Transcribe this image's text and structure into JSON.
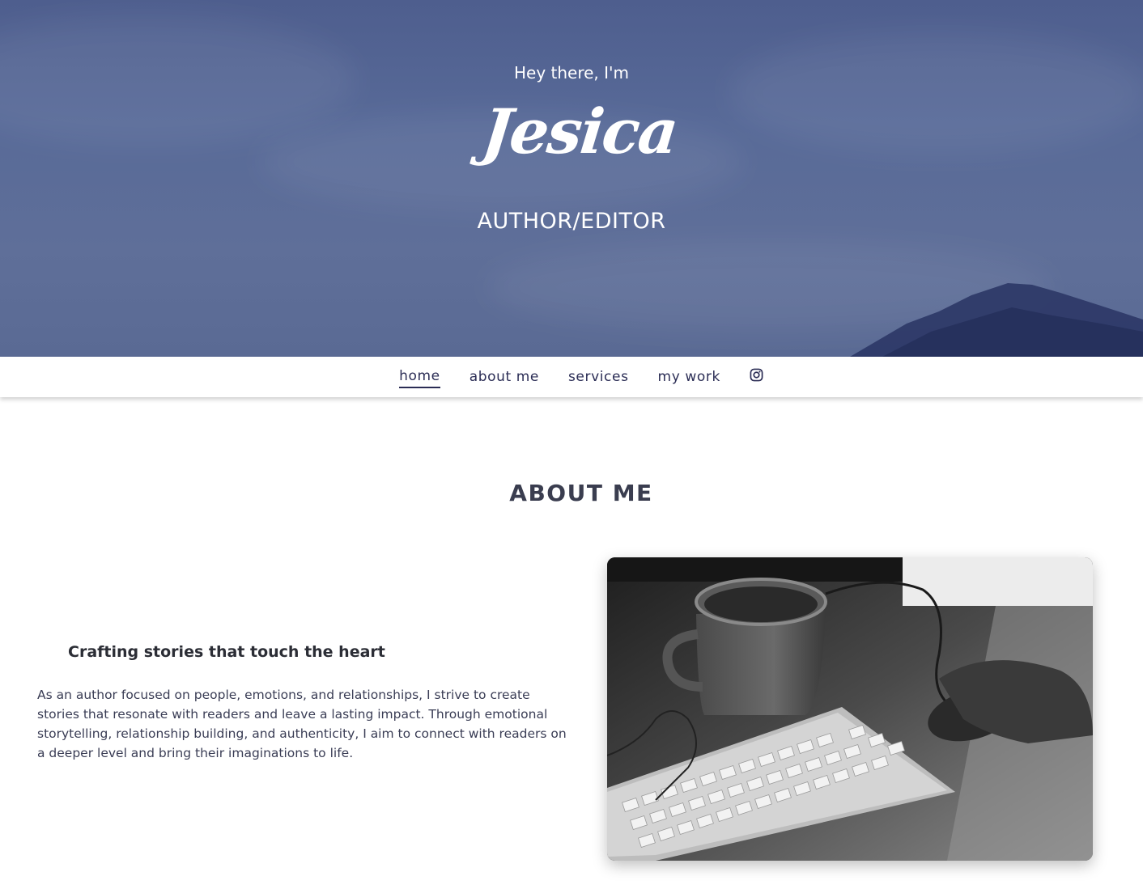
{
  "hero": {
    "greeting": "Hey there, I'm",
    "name": "Jesica",
    "role": "AUTHOR/EDITOR"
  },
  "nav": {
    "items": [
      {
        "label": "home",
        "active": true
      },
      {
        "label": "about me",
        "active": false
      },
      {
        "label": "services",
        "active": false
      },
      {
        "label": "my work",
        "active": false
      }
    ],
    "social_icon": "instagram-icon"
  },
  "about": {
    "title": "ABOUT ME",
    "subtitle": "Crafting stories that touch the heart",
    "body": "As an author focused on people, emotions, and relationships, I strive to create stories that resonate with readers and leave a lasting impact. Through emotional storytelling, relationship building, and authenticity, I aim to connect with readers on a deeper level and bring their imaginations to life.",
    "photo": "desk-with-mug-keyboard-mouse-photo"
  },
  "colors": {
    "hero_bg": "#586a98",
    "nav_text": "#2b2d55",
    "heading": "#3a3d4f"
  }
}
